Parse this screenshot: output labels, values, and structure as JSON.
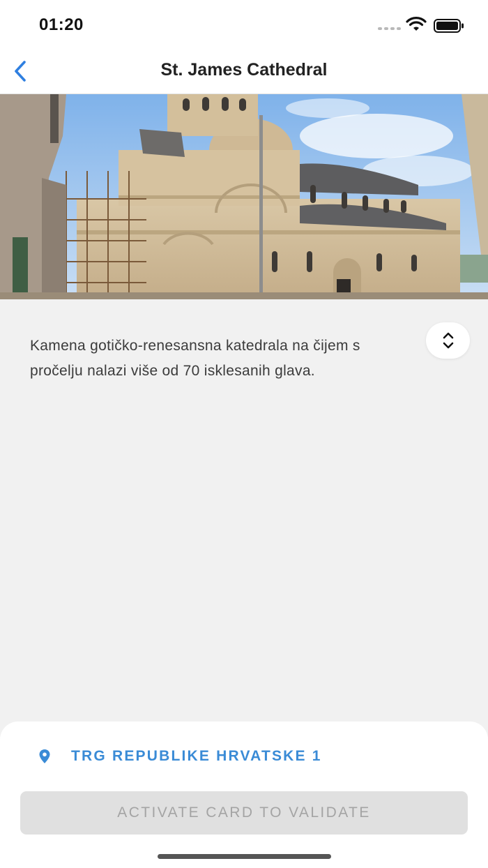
{
  "status_bar": {
    "time": "01:20",
    "icons": [
      "signal-dots-icon",
      "wifi-icon",
      "battery-icon"
    ]
  },
  "nav": {
    "back_icon": "chevron-left-icon",
    "title": "St. James Cathedral"
  },
  "hero": {
    "image": "cathedral-photo"
  },
  "content": {
    "description_line1": "Kamena gotičko-renesansna katedrala na čijem s",
    "description_line2": "pročelju nalazi više od 70 isklesanih glava.",
    "expand_icon": "chevron-up-down-icon"
  },
  "bottom_sheet": {
    "location_icon": "location-pin-icon",
    "address": "TRG REPUBLIKE HRVATSKE 1",
    "activate_label": "ACTIVATE CARD TO VALIDATE"
  },
  "colors": {
    "accent": "#3a8bd6",
    "back_chevron": "#2f7fe0",
    "background": "#f1f1f1",
    "disabled_button": "#e0e0e0",
    "disabled_text": "#a4a4a4"
  }
}
